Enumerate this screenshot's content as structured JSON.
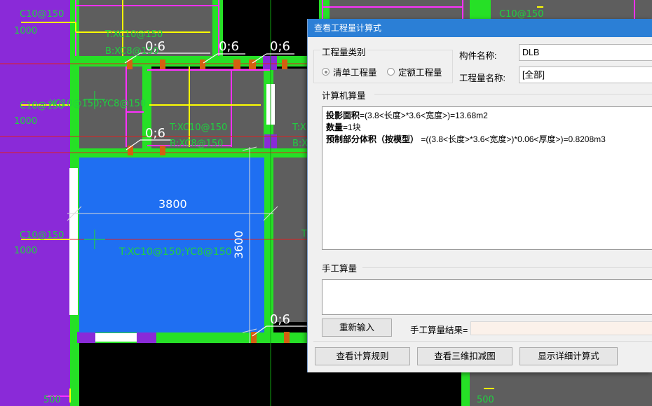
{
  "cad": {
    "dim_width": "3800",
    "dim_height": "3600",
    "rebar_label": "T:XC10@150;YC8@150",
    "partial_label_top": "T:XC10@150",
    "partial_label_bottom": "B:XC8@150",
    "partial_label_top_mid": "T:XC10@150",
    "partial_label_bottom_mid": "B:XC8@150",
    "partial_label_top_right": "T:X",
    "partial_label_bottom_right": "B:X",
    "left_label_1": "C10@150",
    "left_value_1": "1000",
    "left_label_2": "C10@150",
    "left_value_2": "1000",
    "left_label_3": "C10@150",
    "left_value_3": "1000",
    "mid_left_label": "XC10@150;YC8@150",
    "top_right_label": "C10@150",
    "bottom_value_left": "500",
    "bottom_value_right": "500",
    "mark_06": "0;6",
    "right_partial": "T"
  },
  "dialog": {
    "title": "查看工程量计算式",
    "category_legend": "工程量类别",
    "radio_bill": "清单工程量",
    "radio_quota": "定额工程量",
    "component_name_label": "构件名称:",
    "component_name_value": "DLB",
    "quantity_name_label": "工程量名称:",
    "quantity_name_value": "[全部]",
    "computer_calc_legend": "计算机算量",
    "formula_lines": [
      {
        "bold": "投影面积",
        "text": "=(3.8<长度>*3.6<宽度>)=13.68m2"
      },
      {
        "bold": "数量",
        "text": "=1块"
      },
      {
        "bold": "预制部分体积（按模型）",
        "text": "  =((3.8<长度>*3.6<宽度>)*0.06<厚度>)=0.8208m3"
      }
    ],
    "manual_calc_legend": "手工算量",
    "reenter_button": "重新输入",
    "manual_result_label": "手工算量结果=",
    "manual_result_value": "",
    "view_rules_button": "查看计算规则",
    "view_3d_button": "查看三维扣减图",
    "show_detail_button": "显示详细计算式"
  },
  "colors": {
    "cad_background": "#000000",
    "slab_blue": "#1f6ff2",
    "wall_green": "#26e026",
    "purple_fill": "#8a2ad8",
    "magenta_line": "#ff30ff",
    "yellow_line": "#ffff00",
    "rebar_text_green": "#20d040",
    "title_blue": "#2b7fd6"
  }
}
